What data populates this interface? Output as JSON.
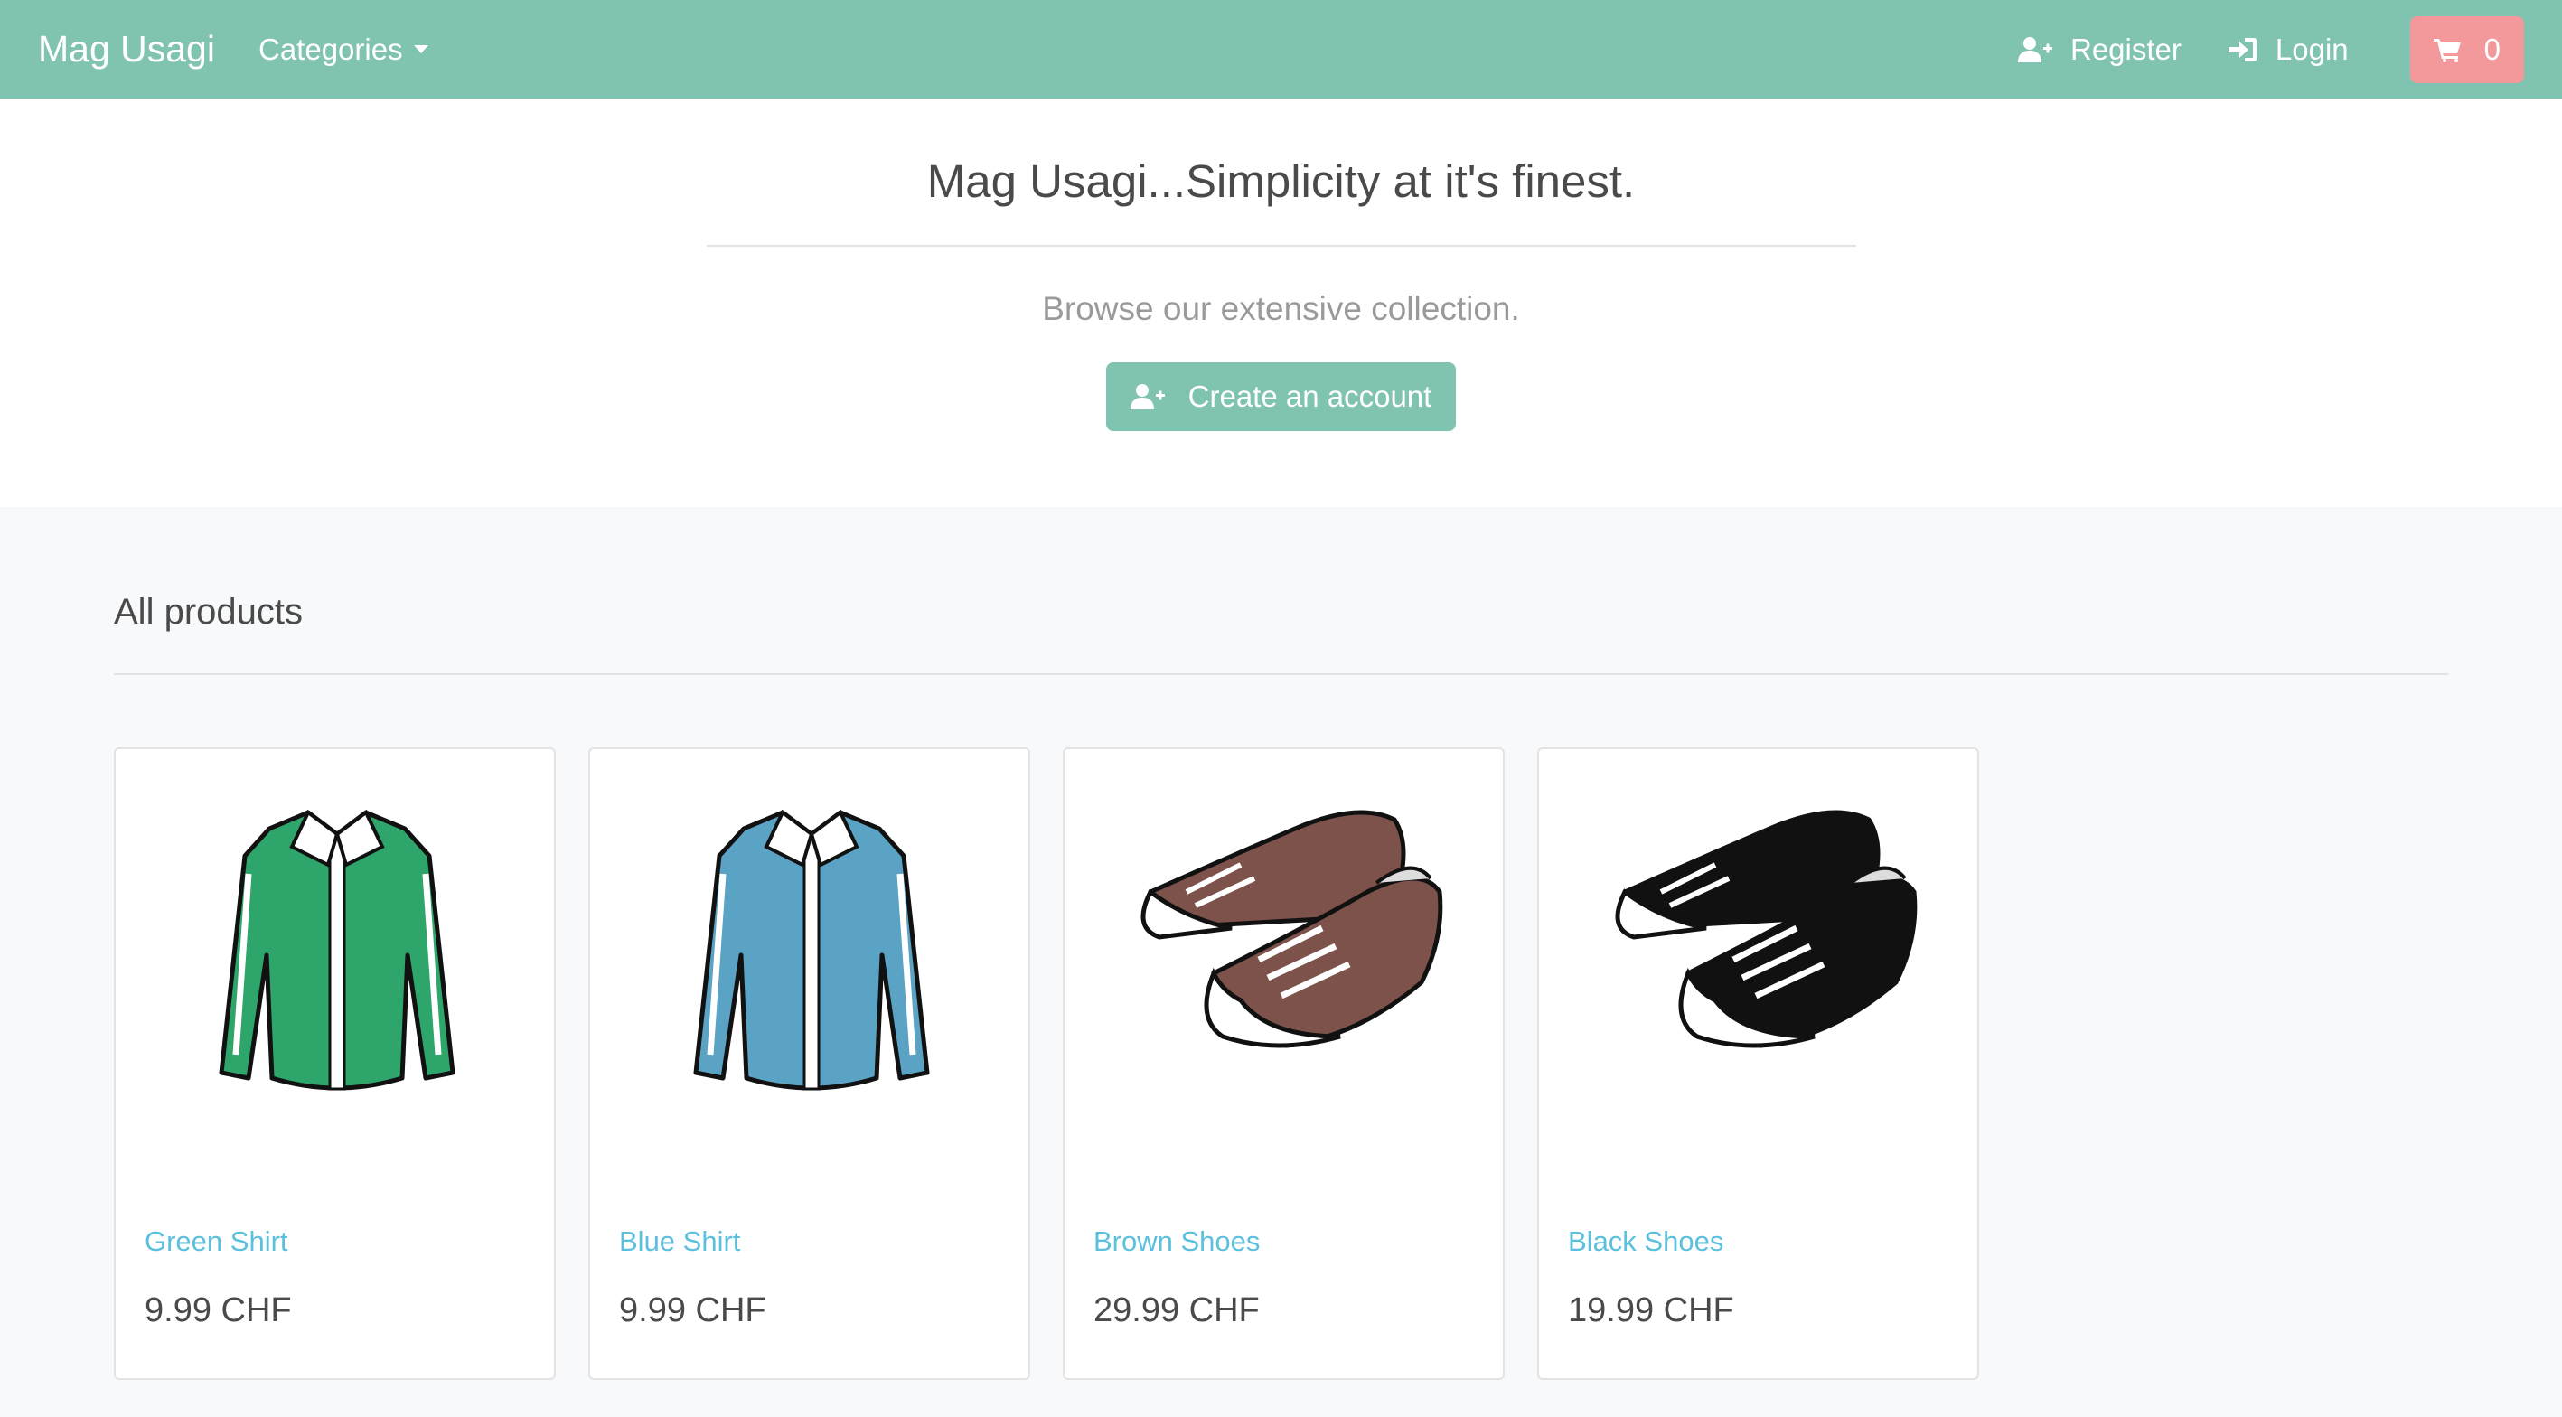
{
  "navbar": {
    "brand": "Mag Usagi",
    "categories_label": "Categories",
    "register_label": "Register",
    "login_label": "Login",
    "cart_count": "0"
  },
  "hero": {
    "title": "Mag Usagi...Simplicity at it's finest.",
    "subtitle": "Browse our extensive collection.",
    "cta_label": "Create an account"
  },
  "products": {
    "title": "All products",
    "items": [
      {
        "name": "Green Shirt",
        "price": "9.99 CHF",
        "color": "#2ea66b",
        "kind": "shirt"
      },
      {
        "name": "Blue Shirt",
        "price": "9.99 CHF",
        "color": "#5ba3c4",
        "kind": "shirt"
      },
      {
        "name": "Brown Shoes",
        "price": "29.99 CHF",
        "color": "#7d524a",
        "kind": "shoes"
      },
      {
        "name": "Black Shoes",
        "price": "19.99 CHF",
        "color": "#111111",
        "kind": "shoes"
      }
    ]
  },
  "colors": {
    "navbar": "#80c3b0",
    "cart": "#f3999b",
    "link": "#5bc0de"
  },
  "icons": [
    "user-plus-icon",
    "sign-in-icon",
    "cart-icon",
    "caret-down-icon"
  ]
}
